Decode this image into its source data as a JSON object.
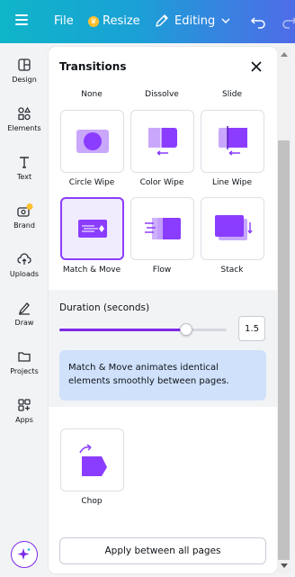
{
  "topbar": {
    "menu_icon": "hamburger-icon",
    "file_label": "File",
    "resize_label": "Resize",
    "editing_label": "Editing",
    "undo_icon": "undo-icon",
    "redo_icon": "redo-icon",
    "gradient": [
      "#0fb5c8",
      "#4f6be8"
    ]
  },
  "rail": {
    "items": [
      {
        "label": "Design",
        "icon": "design-icon"
      },
      {
        "label": "Elements",
        "icon": "elements-icon"
      },
      {
        "label": "Text",
        "icon": "text-icon"
      },
      {
        "label": "Brand",
        "icon": "brand-icon"
      },
      {
        "label": "Uploads",
        "icon": "uploads-icon"
      },
      {
        "label": "Draw",
        "icon": "draw-icon"
      },
      {
        "label": "Projects",
        "icon": "projects-icon"
      },
      {
        "label": "Apps",
        "icon": "apps-icon"
      }
    ],
    "magic_icon": "magic-sparkle-icon"
  },
  "panel": {
    "title": "Transitions",
    "top_labels": [
      "None",
      "Dissolve",
      "Slide"
    ],
    "row1": [
      {
        "label": "Circle Wipe",
        "icon": "circle-wipe-icon"
      },
      {
        "label": "Color Wipe",
        "icon": "color-wipe-icon"
      },
      {
        "label": "Line Wipe",
        "icon": "line-wipe-icon"
      }
    ],
    "row2": [
      {
        "label": "Match & Move",
        "icon": "match-move-icon",
        "selected": true
      },
      {
        "label": "Flow",
        "icon": "flow-icon"
      },
      {
        "label": "Stack",
        "icon": "stack-icon"
      }
    ],
    "duration": {
      "label": "Duration (seconds)",
      "value": "1.5",
      "slider_fraction": 0.76
    },
    "info_text": "Match & Move animates identical elements smoothly between pages.",
    "row3": [
      {
        "label": "Chop",
        "icon": "chop-icon"
      }
    ],
    "apply_label": "Apply between all pages"
  },
  "colors": {
    "accent": "#8b3dff",
    "info_bg": "#cfe1fb"
  }
}
